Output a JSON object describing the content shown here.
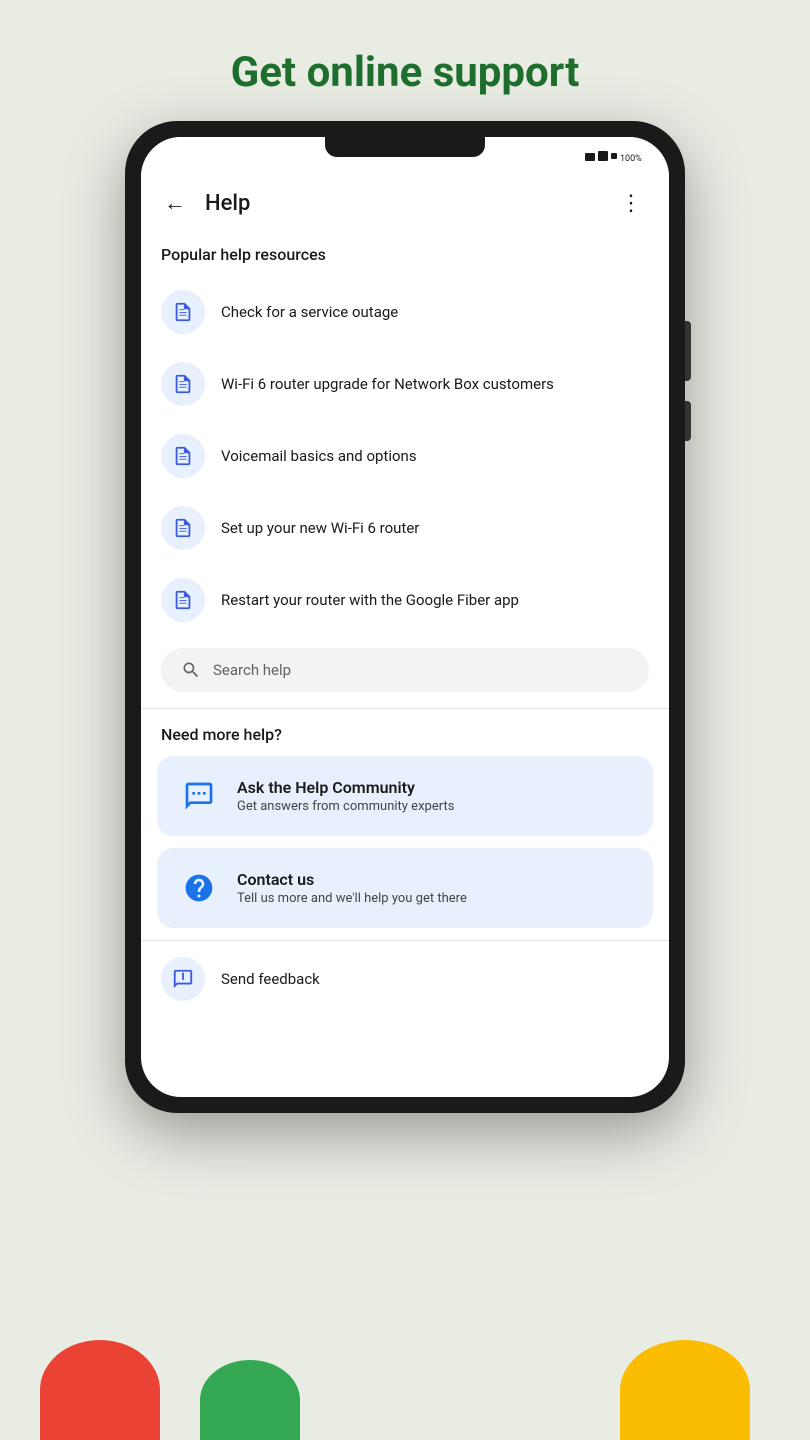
{
  "header": {
    "page_title": "Get online support",
    "app_bar_title": "Help",
    "more_menu_label": "⋮"
  },
  "popular_section": {
    "label": "Popular help resources",
    "items": [
      {
        "text": "Check for a service outage"
      },
      {
        "text": "Wi-Fi 6 router upgrade for Network Box customers"
      },
      {
        "text": "Voicemail basics and options"
      },
      {
        "text": "Set up your new Wi-Fi 6 router"
      },
      {
        "text": "Restart your router with the Google Fiber app"
      }
    ]
  },
  "search": {
    "placeholder": "Search help"
  },
  "more_help_section": {
    "label": "Need more help?",
    "community_card": {
      "title": "Ask the Help Community",
      "subtitle": "Get answers from community experts"
    },
    "contact_card": {
      "title": "Contact us",
      "subtitle": "Tell us more and we'll help you get there"
    }
  },
  "feedback": {
    "label": "Send feedback"
  }
}
